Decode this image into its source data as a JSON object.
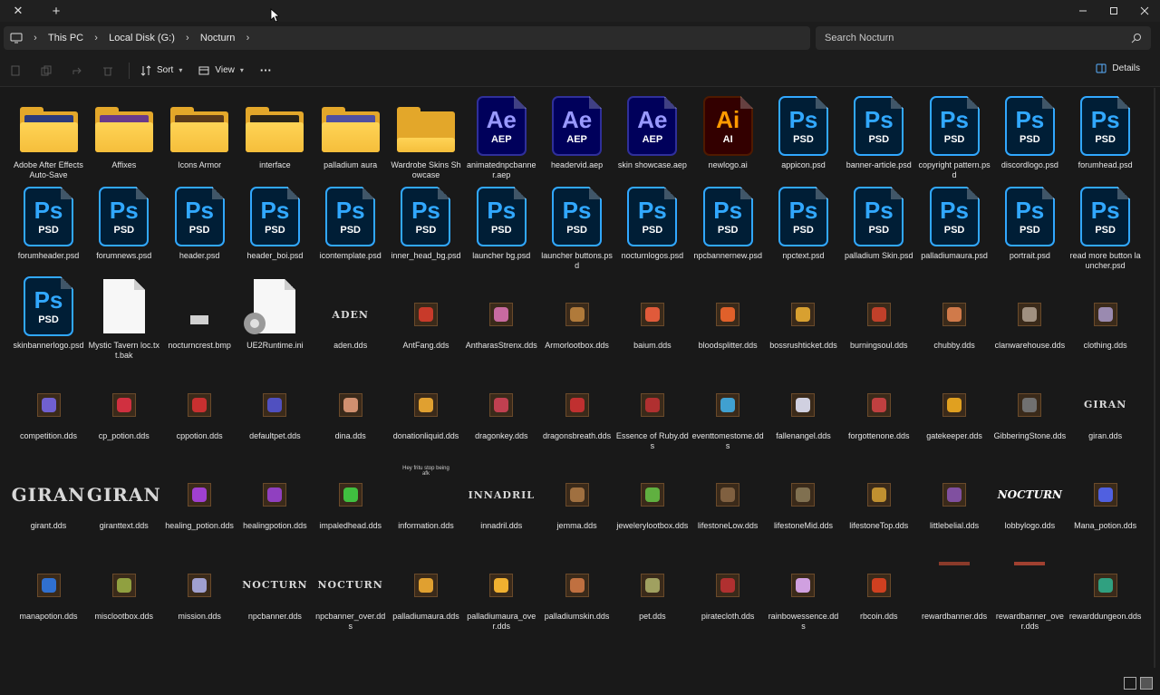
{
  "titlebar": {
    "close_glyph": "✕",
    "add_glyph": "+"
  },
  "address": {
    "crumbs": [
      "This PC",
      "Local Disk (G:)",
      "Nocturn"
    ]
  },
  "search": {
    "placeholder": "Search Nocturn"
  },
  "commandbar": {
    "sort_label": "Sort",
    "view_label": "View",
    "more_label": "···",
    "details_label": "Details"
  },
  "icons": {
    "pc": "monitor-icon",
    "search": "search-icon",
    "cut": "cut-icon",
    "copy": "copy-icon",
    "share": "share-icon",
    "delete": "trash-icon",
    "sort": "sort-icon",
    "view": "view-icon",
    "details": "details-pane-icon"
  },
  "colors": {
    "folder": "#f5be3b",
    "ps": "#31a8ff",
    "ae": "#9999ff",
    "ai": "#ff9a00",
    "background": "#191919"
  },
  "files": [
    {
      "name": "Adobe After Effects Auto-Save",
      "kind": "folder",
      "paper": "#2c3a7a"
    },
    {
      "name": "Affixes",
      "kind": "folder",
      "paper": "#6a3a8a"
    },
    {
      "name": "Icons Armor",
      "kind": "folder",
      "paper": "#5a3a1a"
    },
    {
      "name": "interface",
      "kind": "folder",
      "paper": "#2a2418"
    },
    {
      "name": "palladium aura",
      "kind": "folder",
      "paper": "#5050a0"
    },
    {
      "name": "Wardrobe Skins Showcase",
      "kind": "folder-open"
    },
    {
      "name": "animatednpcbanner.aep",
      "kind": "ae",
      "big": "Ae",
      "small": "AEP"
    },
    {
      "name": "headervid.aep",
      "kind": "ae",
      "big": "Ae",
      "small": "AEP"
    },
    {
      "name": "skin showcase.aep",
      "kind": "ae",
      "big": "Ae",
      "small": "AEP"
    },
    {
      "name": "newlogo.ai",
      "kind": "ai",
      "big": "Ai",
      "small": "AI"
    },
    {
      "name": "appicon.psd",
      "kind": "ps",
      "big": "Ps",
      "small": "PSD"
    },
    {
      "name": "banner-article.psd",
      "kind": "ps",
      "big": "Ps",
      "small": "PSD"
    },
    {
      "name": "copyright pattern.psd",
      "kind": "ps",
      "big": "Ps",
      "small": "PSD"
    },
    {
      "name": "discordlogo.psd",
      "kind": "ps",
      "big": "Ps",
      "small": "PSD"
    },
    {
      "name": "forumhead.psd",
      "kind": "ps",
      "big": "Ps",
      "small": "PSD"
    },
    {
      "name": "forumheader.psd",
      "kind": "ps",
      "big": "Ps",
      "small": "PSD"
    },
    {
      "name": "forumnews.psd",
      "kind": "ps",
      "big": "Ps",
      "small": "PSD"
    },
    {
      "name": "header.psd",
      "kind": "ps",
      "big": "Ps",
      "small": "PSD"
    },
    {
      "name": "header_boi.psd",
      "kind": "ps",
      "big": "Ps",
      "small": "PSD"
    },
    {
      "name": "icontemplate.psd",
      "kind": "ps",
      "big": "Ps",
      "small": "PSD"
    },
    {
      "name": "inner_head_bg.psd",
      "kind": "ps",
      "big": "Ps",
      "small": "PSD"
    },
    {
      "name": "launcher bg.psd",
      "kind": "ps",
      "big": "Ps",
      "small": "PSD"
    },
    {
      "name": "launcher buttons.psd",
      "kind": "ps",
      "big": "Ps",
      "small": "PSD"
    },
    {
      "name": "nocturnlogos.psd",
      "kind": "ps",
      "big": "Ps",
      "small": "PSD"
    },
    {
      "name": "npcbannernew.psd",
      "kind": "ps",
      "big": "Ps",
      "small": "PSD"
    },
    {
      "name": "npctext.psd",
      "kind": "ps",
      "big": "Ps",
      "small": "PSD"
    },
    {
      "name": "palladium Skin.psd",
      "kind": "ps",
      "big": "Ps",
      "small": "PSD"
    },
    {
      "name": "palladiumaura.psd",
      "kind": "ps",
      "big": "Ps",
      "small": "PSD"
    },
    {
      "name": "portrait.psd",
      "kind": "ps",
      "big": "Ps",
      "small": "PSD"
    },
    {
      "name": "read more button launcher.psd",
      "kind": "ps",
      "big": "Ps",
      "small": "PSD"
    },
    {
      "name": "skinbannerlogo.psd",
      "kind": "ps",
      "big": "Ps",
      "small": "PSD"
    },
    {
      "name": "Mystic Tavern loc.txt.bak",
      "kind": "doc"
    },
    {
      "name": "nocturncrest.bmp",
      "kind": "tiny"
    },
    {
      "name": "UE2Runtime.ini",
      "kind": "ini"
    },
    {
      "name": "aden.dds",
      "kind": "text",
      "text": "ADEN"
    },
    {
      "name": "AntFang.dds",
      "kind": "dds",
      "color": "#c83a2a"
    },
    {
      "name": "AntharasStrenx.dds",
      "kind": "dds",
      "color": "#c86aa0"
    },
    {
      "name": "Armorlootbox.dds",
      "kind": "dds",
      "color": "#b07a3a"
    },
    {
      "name": "baium.dds",
      "kind": "dds",
      "color": "#e05a3a"
    },
    {
      "name": "bloodsplitter.dds",
      "kind": "dds",
      "color": "#e0602a"
    },
    {
      "name": "bossrushticket.dds",
      "kind": "dds",
      "color": "#d8a030"
    },
    {
      "name": "burningsoul.dds",
      "kind": "dds",
      "color": "#c0402a"
    },
    {
      "name": "chubby.dds",
      "kind": "dds",
      "color": "#d07a4a"
    },
    {
      "name": "clanwarehouse.dds",
      "kind": "dds",
      "color": "#a09080"
    },
    {
      "name": "clothing.dds",
      "kind": "dds",
      "color": "#9a8ab0"
    },
    {
      "name": "competition.dds",
      "kind": "dds",
      "color": "#7060d0"
    },
    {
      "name": "cp_potion.dds",
      "kind": "dds",
      "color": "#d03040"
    },
    {
      "name": "cppotion.dds",
      "kind": "dds",
      "color": "#c83030"
    },
    {
      "name": "defaultpet.dds",
      "kind": "dds",
      "color": "#5050c0"
    },
    {
      "name": "dina.dds",
      "kind": "dds",
      "color": "#d09070"
    },
    {
      "name": "donationliquid.dds",
      "kind": "dds",
      "color": "#e0a030"
    },
    {
      "name": "dragonkey.dds",
      "kind": "dds",
      "color": "#c04050"
    },
    {
      "name": "dragonsbreath.dds",
      "kind": "dds",
      "color": "#c03030"
    },
    {
      "name": "Essence of Ruby.dds",
      "kind": "dds",
      "color": "#b03030"
    },
    {
      "name": "eventtomestome.dds",
      "kind": "dds",
      "color": "#40a0d0"
    },
    {
      "name": "fallenangel.dds",
      "kind": "dds",
      "color": "#d0d0e0"
    },
    {
      "name": "forgottenone.dds",
      "kind": "dds",
      "color": "#c04040"
    },
    {
      "name": "gatekeeper.dds",
      "kind": "dds",
      "color": "#e0a020"
    },
    {
      "name": "GibberingStone.dds",
      "kind": "dds",
      "color": "#707070"
    },
    {
      "name": "giran.dds",
      "kind": "text",
      "text": "GIRAN"
    },
    {
      "name": "girant.dds",
      "kind": "bigtext",
      "text": "GIRAN"
    },
    {
      "name": "giranttext.dds",
      "kind": "bigtext",
      "text": "GIRAN"
    },
    {
      "name": "healing_potion.dds",
      "kind": "dds",
      "color": "#a040d0"
    },
    {
      "name": "healingpotion.dds",
      "kind": "dds",
      "color": "#9040c0"
    },
    {
      "name": "impaledhead.dds",
      "kind": "dds",
      "color": "#40c040"
    },
    {
      "name": "information.dds",
      "kind": "note",
      "text": "Hey fritu stop being afk"
    },
    {
      "name": "innadril.dds",
      "kind": "text",
      "text": "INNADRIL"
    },
    {
      "name": "jemma.dds",
      "kind": "dds",
      "color": "#a07040"
    },
    {
      "name": "jewelerylootbox.dds",
      "kind": "dds",
      "color": "#60b040"
    },
    {
      "name": "lifestoneLow.dds",
      "kind": "dds",
      "color": "#806040"
    },
    {
      "name": "lifestoneMid.dds",
      "kind": "dds",
      "color": "#807050"
    },
    {
      "name": "lifestoneTop.dds",
      "kind": "dds",
      "color": "#c09030"
    },
    {
      "name": "littlebelial.dds",
      "kind": "dds",
      "color": "#8050a0"
    },
    {
      "name": "lobbylogo.dds",
      "kind": "logo",
      "text": "NOCTURN"
    },
    {
      "name": "Mana_potion.dds",
      "kind": "dds",
      "color": "#5060e0"
    },
    {
      "name": "manapotion.dds",
      "kind": "dds",
      "color": "#3070d0"
    },
    {
      "name": "misclootbox.dds",
      "kind": "dds",
      "color": "#90a040"
    },
    {
      "name": "mission.dds",
      "kind": "dds",
      "color": "#a0a0d0"
    },
    {
      "name": "npcbanner.dds",
      "kind": "text",
      "text": "NOCTURN"
    },
    {
      "name": "npcbanner_over.dds",
      "kind": "text",
      "text": "NOCTURN"
    },
    {
      "name": "palladiumaura.dds",
      "kind": "dds",
      "color": "#e0a030"
    },
    {
      "name": "palladiumaura_over.dds",
      "kind": "dds",
      "color": "#f0b030"
    },
    {
      "name": "palladiumskin.dds",
      "kind": "dds",
      "color": "#c07040"
    },
    {
      "name": "pet.dds",
      "kind": "dds",
      "color": "#a0a060"
    },
    {
      "name": "piratecloth.dds",
      "kind": "dds",
      "color": "#b03030"
    },
    {
      "name": "rainbowessence.dds",
      "kind": "dds",
      "color": "#d0a0e0"
    },
    {
      "name": "rbcoin.dds",
      "kind": "dds",
      "color": "#d04020"
    },
    {
      "name": "rewardbanner.dds",
      "kind": "bar",
      "color": "#8a3a2a"
    },
    {
      "name": "rewardbanner_over.dds",
      "kind": "bar",
      "color": "#a04030"
    },
    {
      "name": "rewarddungeon.dds",
      "kind": "dds",
      "color": "#30a080"
    }
  ]
}
